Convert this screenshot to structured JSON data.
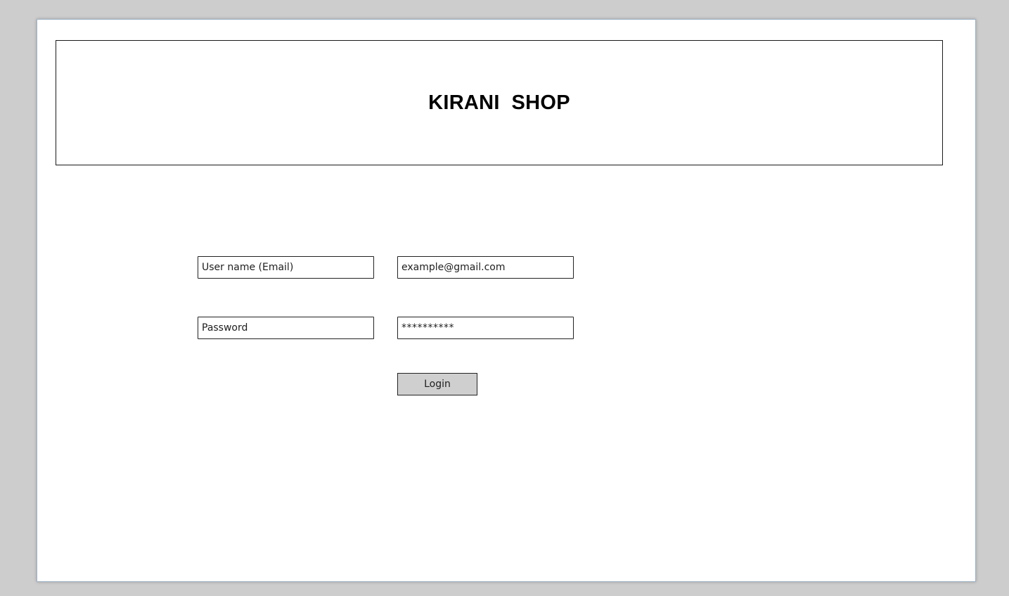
{
  "header": {
    "title": "KIRANI  SHOP"
  },
  "form": {
    "username_label": "User name (Email)",
    "username_value": "example@gmail.com",
    "password_label": "Password",
    "password_value": "**********",
    "login_label": "Login"
  }
}
